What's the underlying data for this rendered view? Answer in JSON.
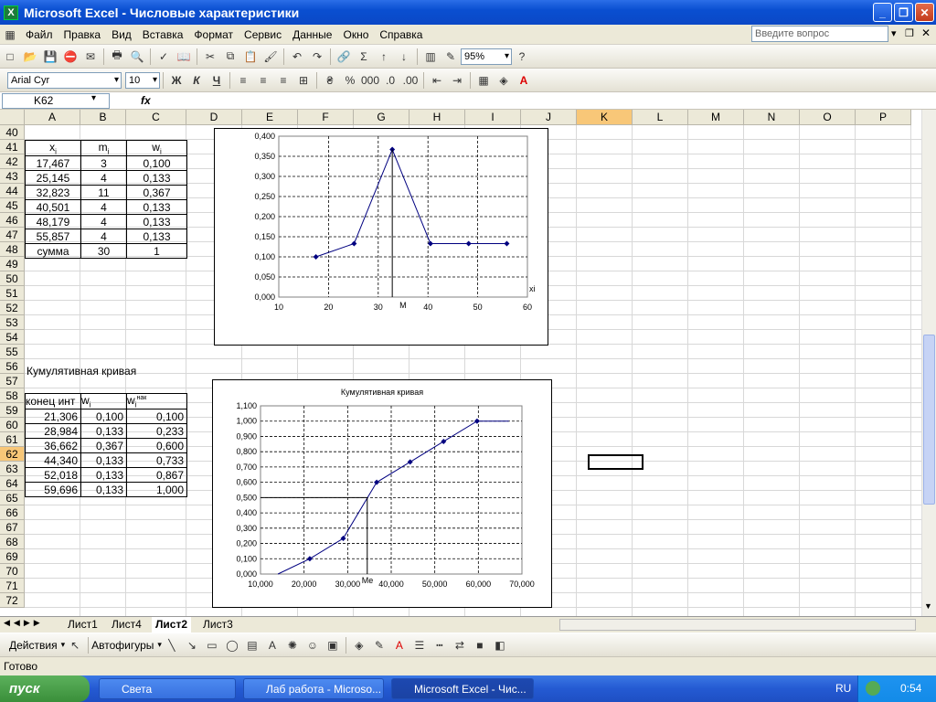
{
  "window": {
    "title": "Microsoft Excel - Числовые характеристики"
  },
  "menu": [
    "Файл",
    "Правка",
    "Вид",
    "Вставка",
    "Формат",
    "Сервис",
    "Данные",
    "Окно",
    "Справка"
  ],
  "ask_placeholder": "Введите вопрос",
  "toolbar": {
    "zoom": "95%"
  },
  "format_toolbar": {
    "font": "Arial Cyr",
    "size": "10",
    "bold": "Ж",
    "italic": "К",
    "underline": "Ч"
  },
  "formula_bar": {
    "name_box": "K62",
    "fx": "fx"
  },
  "columns": [
    "A",
    "B",
    "C",
    "D",
    "E",
    "F",
    "G",
    "H",
    "I",
    "J",
    "K",
    "L",
    "M",
    "N",
    "O",
    "P"
  ],
  "rows": [
    "40",
    "41",
    "42",
    "43",
    "44",
    "45",
    "46",
    "47",
    "48",
    "49",
    "50",
    "51",
    "52",
    "53",
    "54",
    "55",
    "56",
    "57",
    "58",
    "59",
    "60",
    "61",
    "62",
    "63",
    "64",
    "65",
    "66",
    "67",
    "68",
    "69",
    "70",
    "71",
    "72"
  ],
  "table1": {
    "headers": [
      "x",
      "m",
      "w"
    ],
    "header_sub": [
      "i",
      "i",
      "i"
    ],
    "rows": [
      [
        "17,467",
        "3",
        "0,100"
      ],
      [
        "25,145",
        "4",
        "0,133"
      ],
      [
        "32,823",
        "11",
        "0,367"
      ],
      [
        "40,501",
        "4",
        "0,133"
      ],
      [
        "48,179",
        "4",
        "0,133"
      ],
      [
        "55,857",
        "4",
        "0,133"
      ]
    ],
    "sum": [
      "сумма",
      "30",
      "1"
    ]
  },
  "section_title": "Кумулятивная кривая",
  "table2": {
    "headers": [
      "конец инт",
      "w",
      "w"
    ],
    "header_sub": [
      "",
      "i",
      "i"
    ],
    "header_sup": [
      "",
      "",
      "нак"
    ],
    "rows": [
      [
        "21,306",
        "0,100",
        "0,100"
      ],
      [
        "28,984",
        "0,133",
        "0,233"
      ],
      [
        "36,662",
        "0,367",
        "0,600"
      ],
      [
        "44,340",
        "0,133",
        "0,733"
      ],
      [
        "52,018",
        "0,133",
        "0,867"
      ],
      [
        "59,696",
        "0,133",
        "1,000"
      ]
    ]
  },
  "chart_data": [
    {
      "type": "line",
      "x": [
        17.467,
        25.145,
        32.823,
        40.501,
        48.179,
        55.857
      ],
      "values": [
        0.1,
        0.133,
        0.367,
        0.133,
        0.133,
        0.133
      ],
      "xlim": [
        10,
        60
      ],
      "ylim": [
        0,
        0.4
      ],
      "xticks": [
        "10",
        "20",
        "30",
        "40",
        "50",
        "60"
      ],
      "yticks": [
        "0,000",
        "0,050",
        "0,100",
        "0,150",
        "0,200",
        "0,250",
        "0,300",
        "0,350",
        "0,400"
      ],
      "xlabel": "xi",
      "annotation": "M",
      "grid": true
    },
    {
      "type": "line",
      "title": "Кумулятивная кривая",
      "x": [
        14.0,
        21.306,
        28.984,
        36.662,
        44.34,
        52.018,
        59.696,
        67.0
      ],
      "values": [
        0.0,
        0.1,
        0.233,
        0.6,
        0.733,
        0.867,
        1.0,
        1.0
      ],
      "xlim": [
        10000,
        70000
      ],
      "ylim": [
        0,
        1.1
      ],
      "xticks": [
        "10,000",
        "20,000",
        "30,000",
        "40,000",
        "50,000",
        "60,000",
        "70,000"
      ],
      "yticks": [
        "0,000",
        "0,100",
        "0,200",
        "0,300",
        "0,400",
        "0,500",
        "0,600",
        "0,700",
        "0,800",
        "0,900",
        "1,000",
        "1,100"
      ],
      "annotation": "Me",
      "grid": true
    }
  ],
  "sheets": [
    "Лист1",
    "Лист4",
    "Лист2",
    "Лист3"
  ],
  "draw_toolbar": {
    "actions": "Действия",
    "autoshapes": "Автофигуры"
  },
  "status": "Готово",
  "taskbar": {
    "start": "пуск",
    "tasks": [
      "Света",
      "Лаб работа - Microso...",
      "Microsoft Excel - Чис..."
    ],
    "lang": "RU",
    "clock": "0:54"
  }
}
